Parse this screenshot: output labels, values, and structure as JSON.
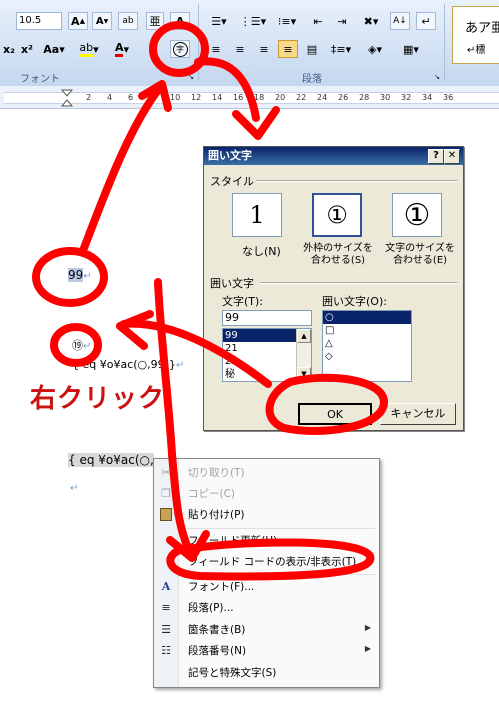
{
  "ribbon": {
    "font_size": "10.5",
    "font_group_label": "フォント",
    "paragraph_group_label": "段落",
    "style_gallery_text": "あア亜",
    "style_gallery_sub": "↵標",
    "font_buttons": [
      "x₂",
      "x²",
      "Aa▾",
      "A",
      "A"
    ],
    "enclose_char_glyph": "字"
  },
  "ruler": {
    "numbers": [
      "2",
      "4",
      "6",
      "8",
      "10",
      "12",
      "14",
      "16",
      "18",
      "20",
      "22",
      "24",
      "26",
      "28",
      "30",
      "32",
      "34",
      "36"
    ]
  },
  "document": {
    "line1": "99",
    "line2_glyph": "⑲",
    "field_code_1": "{ eq ¥o¥ac(○,99)}",
    "field_code_2": "{ eq ¥o¥ac(○,",
    "paragraph_mark": "↵",
    "annotation_right_click": "右クリック"
  },
  "dialog": {
    "title": "囲い文字",
    "help_button": "?",
    "close_button": "✕",
    "section_style": "スタイル",
    "style_options": [
      {
        "glyph": "1",
        "label": "なし(N)"
      },
      {
        "glyph": "①",
        "label": "外枠のサイズを\n合わせる(S)"
      },
      {
        "glyph": "①",
        "label": "文字のサイズを\n合わせる(E)"
      }
    ],
    "section_enclose": "囲い文字",
    "char_label": "文字(T):",
    "char_value": "99",
    "char_list": [
      "99",
      "21",
      "22",
      "秘"
    ],
    "enclose_label": "囲い文字(O):",
    "enclose_list": [
      "○",
      "□",
      "△",
      "◇"
    ],
    "ok": "OK",
    "cancel": "キャンセル"
  },
  "context_menu": {
    "items": [
      {
        "icon": "scissors-icon",
        "glyph": "✂",
        "label": "切り取り(T)",
        "disabled": true
      },
      {
        "icon": "copy-icon",
        "glyph": "❐",
        "label": "コピー(C)",
        "disabled": true
      },
      {
        "icon": "paste-icon",
        "glyph": "📋",
        "label": "貼り付け(P)",
        "disabled": false
      },
      {
        "icon": "update-field-icon",
        "glyph": "",
        "label": "フィールド更新(U)",
        "disabled": false
      },
      {
        "icon": "",
        "glyph": "",
        "label": "フィールド コードの表示/非表示(T)",
        "disabled": false
      },
      {
        "icon": "font-icon",
        "glyph": "A",
        "label": "フォント(F)...",
        "disabled": false
      },
      {
        "icon": "paragraph-icon",
        "glyph": "≡",
        "label": "段落(P)...",
        "disabled": false
      },
      {
        "icon": "bullets-icon",
        "glyph": "☰",
        "label": "箇条書き(B)",
        "disabled": false,
        "submenu": true
      },
      {
        "icon": "numbering-icon",
        "glyph": "☷",
        "label": "段落番号(N)",
        "disabled": false,
        "submenu": true
      },
      {
        "icon": "",
        "glyph": "",
        "label": "記号と特殊文字(S)",
        "disabled": false
      }
    ]
  },
  "colors": {
    "annotation_red": "#ff0000",
    "dialog_title": "#0a246a",
    "selection": "#b9c8e2"
  }
}
